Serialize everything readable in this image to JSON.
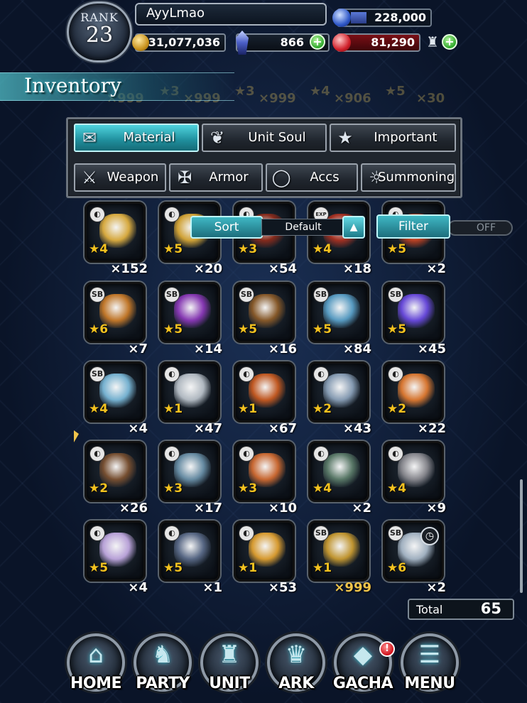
{
  "header": {
    "rank_label": "RANK",
    "rank_value": "23",
    "player_name": "AyyLmao",
    "energy": "228,000",
    "gil": "31,077,036",
    "lapis": "866",
    "hp_stat": "81,290",
    "plus_symbol": "+"
  },
  "inventory": {
    "title": "Inventory",
    "ghost_row": [
      "×999",
      "×999",
      "×999",
      "×906",
      "×30"
    ],
    "ghost_stars": [
      "★3",
      "★3",
      "★4",
      "★5"
    ]
  },
  "tabs": {
    "row1": [
      {
        "label": "Material",
        "icon": "bag-icon",
        "active": true
      },
      {
        "label": "Unit Soul",
        "icon": "soul-icon",
        "active": false
      },
      {
        "label": "Important",
        "icon": "star-icon",
        "active": false
      }
    ],
    "row2": [
      {
        "label": "Weapon",
        "icon": "sword-icon"
      },
      {
        "label": "Armor",
        "icon": "armor-icon"
      },
      {
        "label": "Accs",
        "icon": "ring-icon"
      },
      {
        "label": "Summoning",
        "icon": "summoning-icon"
      }
    ]
  },
  "sort": {
    "label": "Sort",
    "value": "Default"
  },
  "filter": {
    "label": "Filter",
    "state": "OFF"
  },
  "items": [
    {
      "tag": "◐",
      "stars": "★4",
      "qty": "×152",
      "art": "#e0b040"
    },
    {
      "tag": "◐",
      "stars": "★5",
      "qty": "×20",
      "art": "#d9a836"
    },
    {
      "tag": "◐",
      "stars": "★3",
      "qty": "×54",
      "art": "#8a2a1a"
    },
    {
      "tag": "EXP",
      "stars": "★4",
      "qty": "×18",
      "art": "#a83020"
    },
    {
      "tag": "◐",
      "stars": "★5",
      "qty": "×2",
      "art": "#c04020"
    },
    {
      "tag": "SB",
      "stars": "★6",
      "qty": "×7",
      "art": "#c87a28"
    },
    {
      "tag": "SB",
      "stars": "★5",
      "qty": "×14",
      "art": "#8a38b8"
    },
    {
      "tag": "SB",
      "stars": "★5",
      "qty": "×16",
      "art": "#8a5a28"
    },
    {
      "tag": "SB",
      "stars": "★5",
      "qty": "×84",
      "art": "#5aa0c8"
    },
    {
      "tag": "SB",
      "stars": "★5",
      "qty": "×45",
      "art": "#6a4ae0"
    },
    {
      "tag": "SB",
      "stars": "★4",
      "qty": "×4",
      "art": "#7ab8d8"
    },
    {
      "tag": "◐",
      "stars": "★1",
      "qty": "×47",
      "art": "#b8c0c8"
    },
    {
      "tag": "◐",
      "stars": "★1",
      "qty": "×67",
      "art": "#c85a20"
    },
    {
      "tag": "◐",
      "stars": "★2",
      "qty": "×43",
      "art": "#8aa0b8"
    },
    {
      "tag": "◐",
      "stars": "★2",
      "qty": "×22",
      "art": "#e07a30"
    },
    {
      "tag": "◐",
      "stars": "★2",
      "qty": "×26",
      "art": "#7a5030"
    },
    {
      "tag": "◐",
      "stars": "★3",
      "qty": "×17",
      "art": "#6a90a8"
    },
    {
      "tag": "◐",
      "stars": "★3",
      "qty": "×10",
      "art": "#d06a30"
    },
    {
      "tag": "◐",
      "stars": "★4",
      "qty": "×2",
      "art": "#5a7a68"
    },
    {
      "tag": "◐",
      "stars": "★4",
      "qty": "×9",
      "art": "#8a8a90"
    },
    {
      "tag": "◐",
      "stars": "★5",
      "qty": "×4",
      "art": "#c0a8e0"
    },
    {
      "tag": "◐",
      "stars": "★5",
      "qty": "×1",
      "art": "#5a6a88"
    },
    {
      "tag": "◐",
      "stars": "★1",
      "qty": "×53",
      "art": "#e0a030"
    },
    {
      "tag": "SB",
      "stars": "★1",
      "qty": "×999",
      "art": "#c89a30",
      "gold_qty": true
    },
    {
      "tag": "SB",
      "stars": "★6",
      "qty": "×2",
      "art": "#a8b8c8",
      "clock": true
    }
  ],
  "total": {
    "label": "Total",
    "value": "65"
  },
  "nav": [
    {
      "label": "HOME",
      "icon": "home-icon",
      "glyph": "⌂"
    },
    {
      "label": "PARTY",
      "icon": "party-icon",
      "glyph": "♞"
    },
    {
      "label": "UNIT",
      "icon": "unit-icon",
      "glyph": "♜"
    },
    {
      "label": "ARK",
      "icon": "ark-icon",
      "glyph": "♛"
    },
    {
      "label": "GACHA",
      "icon": "gacha-icon",
      "glyph": "◆"
    },
    {
      "label": "MENU",
      "icon": "menu-icon",
      "glyph": "☰"
    }
  ],
  "gacha_badge": "!"
}
